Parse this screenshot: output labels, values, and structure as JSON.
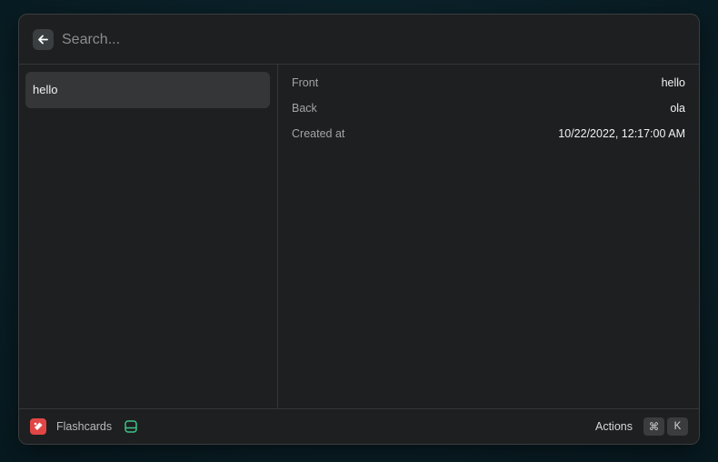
{
  "search": {
    "placeholder": "Search..."
  },
  "list": {
    "items": [
      {
        "label": "hello"
      }
    ]
  },
  "detail": {
    "rows": [
      {
        "label": "Front",
        "value": "hello"
      },
      {
        "label": "Back",
        "value": "ola"
      },
      {
        "label": "Created at",
        "value": "10/22/2022, 12:17:00 AM"
      }
    ]
  },
  "footer": {
    "extension_name": "Flashcards",
    "extension_icon": "flashcards-icon",
    "dev_icon": "development-mode-icon",
    "actions_label": "Actions",
    "shortcut_keys": [
      "⌘",
      "K"
    ]
  },
  "colors": {
    "window_bg": "#1d1f20",
    "selected_item_bg": "#343637",
    "extension_icon_bg": "#e14646",
    "dev_icon_color": "#3ec48a"
  }
}
